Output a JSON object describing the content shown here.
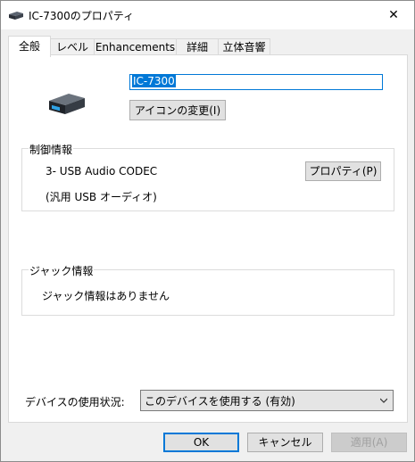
{
  "window": {
    "title": "IC-7300のプロパティ",
    "close_glyph": "✕"
  },
  "tabs": [
    {
      "label": "全般",
      "active": true
    },
    {
      "label": "レベル"
    },
    {
      "label": "Enhancements"
    },
    {
      "label": "詳細"
    },
    {
      "label": "立体音響"
    }
  ],
  "general": {
    "device_name": "IC-7300",
    "change_icon_label": "アイコンの変更(I)"
  },
  "controller_info": {
    "legend": "制御情報",
    "device": "3- USB Audio CODEC",
    "subtitle": "(汎用 USB オーディオ)",
    "properties_label": "プロパティ(P)"
  },
  "jack_info": {
    "legend": "ジャック情報",
    "message": "ジャック情報はありません"
  },
  "device_usage": {
    "label": "デバイスの使用状況:",
    "selected": "このデバイスを使用する (有効)"
  },
  "buttons": {
    "ok": "OK",
    "cancel": "キャンセル",
    "apply": "適用(A)"
  },
  "colors": {
    "accent": "#0078d7",
    "panel": "#ffffff",
    "background": "#f0f0f0"
  }
}
